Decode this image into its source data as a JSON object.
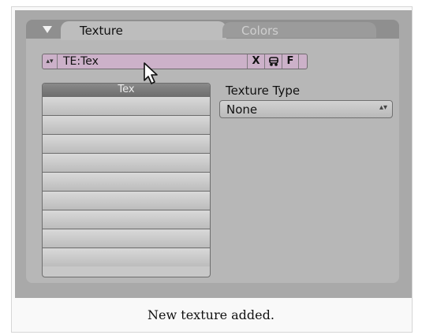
{
  "tabs": {
    "texture_label": "Texture",
    "colors_label": "Colors"
  },
  "texture_field": {
    "value": "TE:Tex",
    "buttons": [
      "X",
      "F"
    ],
    "spin_glyph": "▴▾",
    "fake_user_icon": "car-icon"
  },
  "texture_list": {
    "header": "Tex",
    "rows": [
      "",
      "",
      "",
      "",
      "",
      "",
      "",
      "",
      ""
    ]
  },
  "texture_type": {
    "label": "Texture Type",
    "value": "None",
    "arrows": "▴▾"
  },
  "caption": "New texture added.",
  "colors": {
    "panel_bg": "#b7b7b7",
    "field_bg": "#ccb1c9"
  }
}
